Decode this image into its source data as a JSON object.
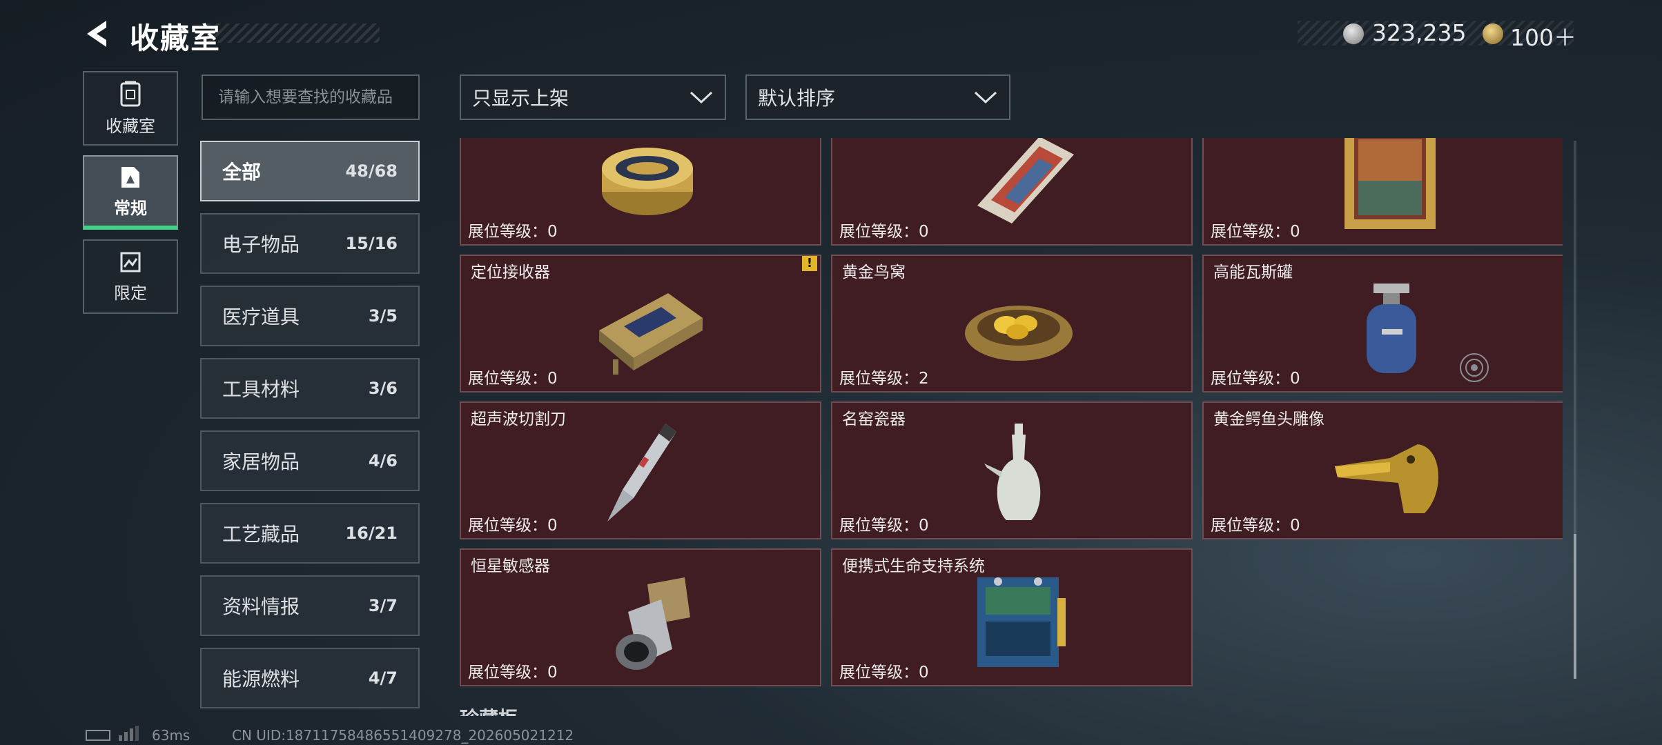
{
  "header": {
    "title": "收藏室",
    "currency": [
      {
        "icon": "silver-coin-icon",
        "value": "323,235"
      },
      {
        "icon": "gold-coin-icon",
        "value": "100＋"
      }
    ]
  },
  "nav": [
    {
      "label": "收藏室",
      "icon": "collection-room-icon"
    },
    {
      "label": "常规",
      "icon": "regular-icon",
      "active": true
    },
    {
      "label": "限定",
      "icon": "limited-icon"
    }
  ],
  "search": {
    "placeholder": "请输入想要查找的收藏品"
  },
  "categories": [
    {
      "name": "全部",
      "count": "48/68",
      "active": true
    },
    {
      "name": "电子物品",
      "count": "15/16"
    },
    {
      "name": "医疗道具",
      "count": "3/5"
    },
    {
      "name": "工具材料",
      "count": "3/6"
    },
    {
      "name": "家居物品",
      "count": "4/6"
    },
    {
      "name": "工艺藏品",
      "count": "16/21"
    },
    {
      "name": "资料情报",
      "count": "3/7"
    },
    {
      "name": "能源燃料",
      "count": "4/7"
    }
  ],
  "filters": {
    "show_filter": "只显示上架",
    "sort": "默认排序"
  },
  "items": [
    {
      "name": "",
      "level_label": "展位等级：",
      "level": "0",
      "icon": "caviar-tin-icon"
    },
    {
      "name": "",
      "level_label": "展位等级：",
      "level": "0",
      "icon": "decorated-card-icon"
    },
    {
      "name": "",
      "level_label": "展位等级：",
      "level": "0",
      "icon": "framed-painting-icon"
    },
    {
      "name": "定位接收器",
      "level_label": "展位等级：",
      "level": "0",
      "icon": "gps-receiver-icon",
      "warning": "!"
    },
    {
      "name": "黄金鸟窝",
      "level_label": "展位等级：",
      "level": "2",
      "icon": "golden-nest-icon"
    },
    {
      "name": "高能瓦斯罐",
      "level_label": "展位等级：",
      "level": "0",
      "icon": "gas-canister-icon"
    },
    {
      "name": "超声波切割刀",
      "level_label": "展位等级：",
      "level": "0",
      "icon": "ultrasonic-cutter-icon"
    },
    {
      "name": "名窑瓷器",
      "level_label": "展位等级：",
      "level": "0",
      "icon": "porcelain-vase-icon"
    },
    {
      "name": "黄金鳄鱼头雕像",
      "level_label": "展位等级：",
      "level": "0",
      "icon": "gold-crocodile-head-icon"
    },
    {
      "name": "恒星敏感器",
      "level_label": "展位等级：",
      "level": "0",
      "icon": "star-sensor-icon"
    },
    {
      "name": "便携式生命支持系统",
      "level_label": "展位等级：",
      "level": "0",
      "icon": "life-support-icon"
    }
  ],
  "section_next": "珍藏柜",
  "footer": {
    "ping": "63ms",
    "uid": "CN UID:18711758486551409278_202605021212"
  },
  "colors": {
    "card_bg": "#3f1d22",
    "active_tab_underline": "#3fd48a",
    "warning": "#e2b52a"
  }
}
